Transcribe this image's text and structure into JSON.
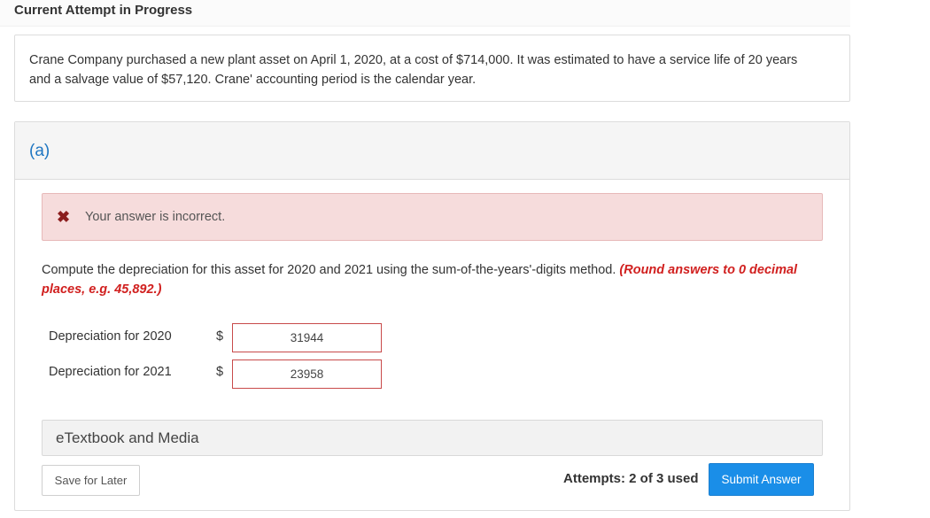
{
  "header": {
    "title": "Current Attempt in Progress"
  },
  "question": {
    "text": "Crane Company purchased a new plant asset on April 1, 2020, at a cost of $714,000. It was estimated to have a service life of 20 years and a salvage value of $57,120. Crane' accounting period is the calendar year."
  },
  "part": {
    "label": "(a)",
    "alert": {
      "icon": "x-icon",
      "glyph": "✖",
      "message": "Your answer is incorrect."
    },
    "instruction": {
      "text": "Compute the depreciation for this asset for 2020 and 2021 using the sum-of-the-years'-digits method. ",
      "hint": "(Round answers to 0 decimal places, e.g. 45,892.)"
    },
    "rows": [
      {
        "label": "Depreciation for 2020",
        "currency": "$",
        "value": "31944"
      },
      {
        "label": "Depreciation for 2021",
        "currency": "$",
        "value": "23958"
      }
    ],
    "etextbook_label": "eTextbook and Media",
    "footer": {
      "save_label": "Save for Later",
      "attempts_text": "Attempts: 2 of 3 used",
      "submit_label": "Submit Answer"
    }
  },
  "colors": {
    "accent": "#1a8ee8",
    "part_label": "#1f76c2",
    "error_bg": "#f6dcdc",
    "error_icon": "#8b1e1e",
    "hint": "#d1201f",
    "input_error_border": "#c84a4a"
  }
}
